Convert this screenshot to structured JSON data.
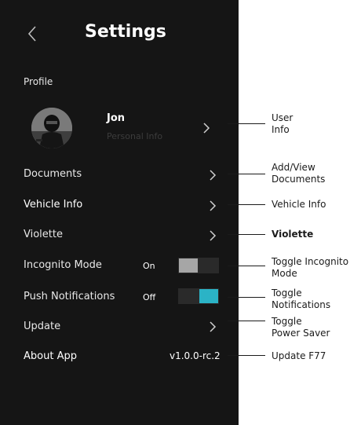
{
  "header": {
    "title": "Settings",
    "back_icon": "chevron-left-icon"
  },
  "profile": {
    "section_label": "Profile",
    "name": "Jon",
    "subtitle": "Personal Info"
  },
  "rows": {
    "documents": "Documents",
    "vehicle_info": "Vehicle Info",
    "violette": "Violette",
    "incognito": "Incognito Mode",
    "incognito_state": "On",
    "incognito_on": true,
    "push": "Push Notifications",
    "push_state": "Off",
    "push_on": false,
    "update": "Update",
    "about": "About App",
    "version": "v1.0.0-rc.2"
  },
  "callouts": {
    "user_info_1": "User",
    "user_info_2": "Info",
    "documents_1": "Add/View",
    "documents_2": "Documents",
    "vehicle_info": "Vehicle Info",
    "violette": "Violette",
    "incognito_1": "Toggle Incognito",
    "incognito_2": "Mode",
    "push_1": "Toggle",
    "push_2": "Notifications",
    "update_1": "Toggle",
    "update_2": "Power Saver",
    "about": "Update F77"
  },
  "colors": {
    "panel_bg": "#151515",
    "toggle_on_knob": "#a6a6a6",
    "toggle_accent": "#2bb3c6",
    "muted_text": "#3c3c3c"
  }
}
